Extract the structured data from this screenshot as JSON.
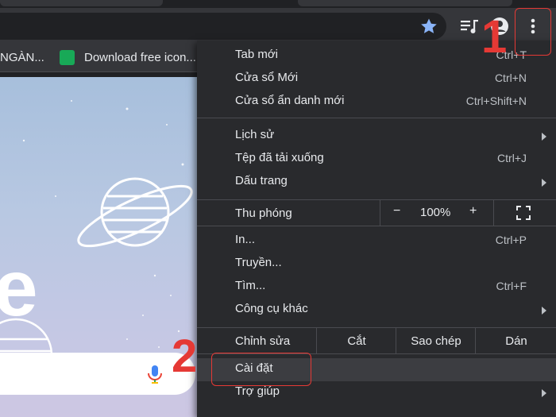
{
  "bookmarks": [
    {
      "label": "NGÀN..."
    },
    {
      "label": "Download free icon..."
    }
  ],
  "toolbar": {
    "bookmark_star_icon": "star-icon",
    "media_icon": "playlist-music-icon",
    "profile_icon": "profile-icon",
    "menu_icon": "kebab-menu-icon"
  },
  "menu": {
    "group1": [
      {
        "label": "Tab mới",
        "shortcut": "Ctrl+T"
      },
      {
        "label": "Cửa sổ Mới",
        "shortcut": "Ctrl+N"
      },
      {
        "label": "Cửa sổ ẩn danh mới",
        "shortcut": "Ctrl+Shift+N"
      }
    ],
    "group2": [
      {
        "label": "Lịch sử",
        "submenu": true
      },
      {
        "label": "Tệp đã tải xuống",
        "shortcut": "Ctrl+J"
      },
      {
        "label": "Dấu trang",
        "submenu": true
      }
    ],
    "zoom": {
      "label": "Thu phóng",
      "minus": "−",
      "value": "100%",
      "plus": "+"
    },
    "group3": [
      {
        "label": "In...",
        "shortcut": "Ctrl+P"
      },
      {
        "label": "Truyền..."
      },
      {
        "label": "Tìm...",
        "shortcut": "Ctrl+F"
      },
      {
        "label": "Công cụ khác",
        "submenu": true
      }
    ],
    "edit": {
      "label": "Chỉnh sửa",
      "cut": "Cắt",
      "copy": "Sao chép",
      "paste": "Dán"
    },
    "group4": [
      {
        "label": "Cài đặt"
      },
      {
        "label": "Trợ giúp",
        "submenu": true
      }
    ]
  },
  "annotations": {
    "step1": "1",
    "step2": "2",
    "color": "#e53935"
  },
  "content": {
    "big_letter": "e"
  },
  "colors": {
    "menu_bg": "#292a2d",
    "toolbar_bg": "#35363a",
    "accent_star": "#8ab4f8"
  }
}
